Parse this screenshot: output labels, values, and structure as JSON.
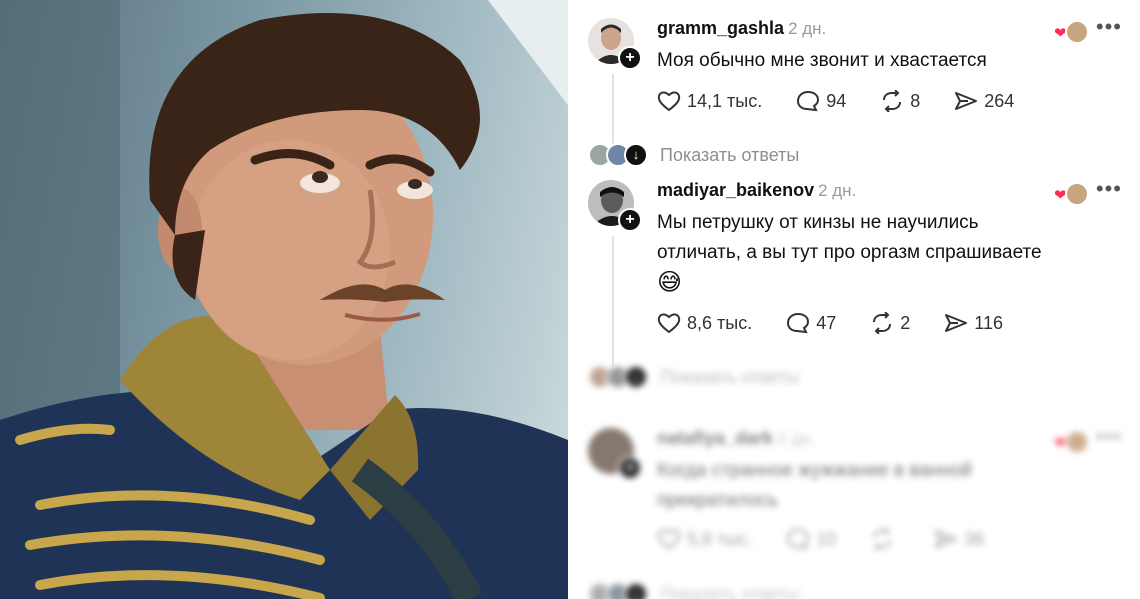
{
  "comments": [
    {
      "username": "gramm_gashla",
      "ago": "2 дн.",
      "text": "Моя обычно мне звонит и хвастается",
      "likes": "14,1 тыс.",
      "replies": "94",
      "reposts": "8",
      "shares": "264"
    },
    {
      "username": "madiyar_baikenov",
      "ago": "2 дн.",
      "text_line1": "Мы петрушку от кинзы не научились",
      "text_line2": "отличать, а вы тут про оргазм спрашиваете",
      "emoji": "😅",
      "likes": "8,6 тыс.",
      "replies": "47",
      "reposts": "2",
      "shares": "116"
    },
    {
      "username": "natafiya_dark",
      "ago": "2 дн.",
      "text_line1": "Когда странное жужжание в ванной",
      "text_line2": "прекратилось",
      "likes": "5,8 тыс.",
      "replies": "10",
      "reposts": "",
      "shares": "36"
    }
  ],
  "show_replies_label": "Показать ответы",
  "more_glyph": "•••",
  "colors": {
    "heart": "#ff2d55",
    "muted": "#8e8e8e",
    "text": "#111111"
  }
}
